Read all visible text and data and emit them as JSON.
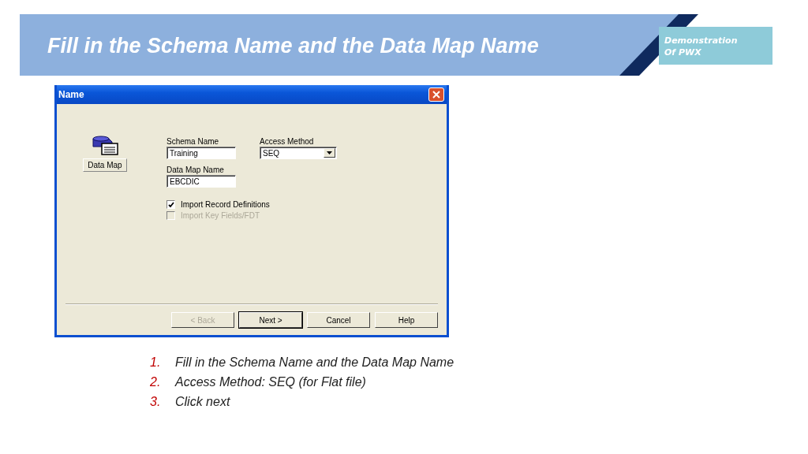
{
  "slide": {
    "title": "Fill in the Schema Name and the Data Map Name",
    "badge": [
      "Demonstration",
      "Of PWX"
    ]
  },
  "dialog": {
    "title": "Name",
    "icon_label": "Data Map",
    "fields": [
      {
        "label": "Schema Name",
        "value": "Training",
        "kind": "text"
      },
      {
        "label": "Access Method",
        "value": "SEQ",
        "kind": "combo"
      },
      {
        "label": "Data Map Name",
        "value": "EBCDIC",
        "kind": "text"
      }
    ],
    "checkboxes": [
      {
        "label": "Import Record Definitions",
        "checked": true,
        "disabled": false
      },
      {
        "label": "Import Key Fields/FDT",
        "checked": false,
        "disabled": true
      }
    ],
    "buttons": [
      {
        "label": "< Back",
        "disabled": true,
        "default": false
      },
      {
        "label": "Next >",
        "disabled": false,
        "default": true
      },
      {
        "label": "Cancel",
        "disabled": false,
        "default": false
      },
      {
        "label": "Help",
        "disabled": false,
        "default": false
      }
    ]
  },
  "steps": [
    {
      "number": "1.",
      "text": "Fill in the Schema Name and the Data Map Name"
    },
    {
      "number": "2.",
      "text": "Access Method: SEQ (for Flat file)"
    },
    {
      "number": "3.",
      "text": "Click next"
    }
  ]
}
